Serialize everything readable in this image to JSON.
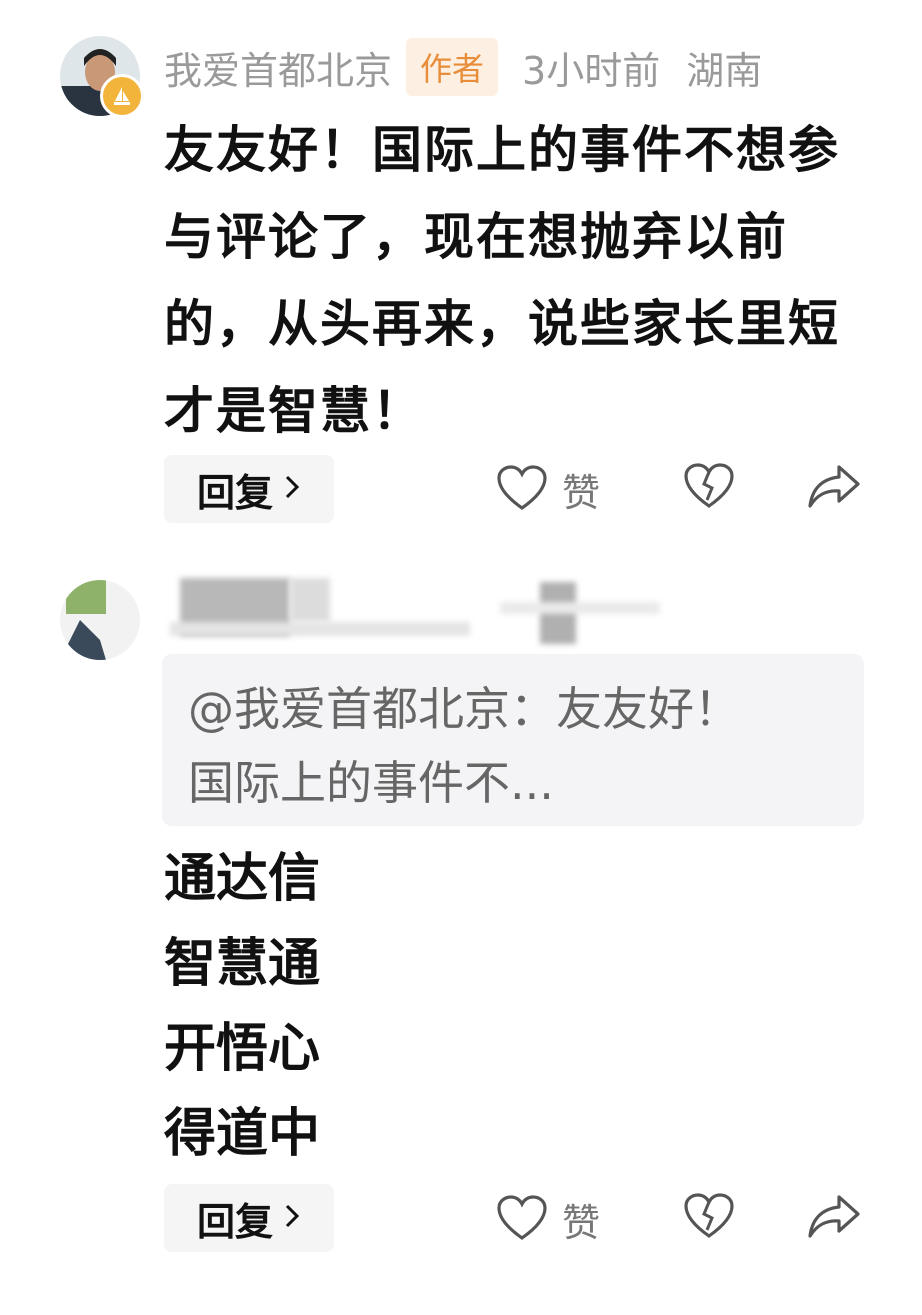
{
  "comments": [
    {
      "username": "我爱首都北京",
      "author_tag": "作者",
      "time": "3小时前",
      "region": "湖南",
      "text": "友友好！国际上的事件不想参与评论了，现在想抛弃以前的，从头再来，说些家长里短才是智慧！",
      "reply_label": "回复",
      "like_label": "赞"
    },
    {
      "quote": "@我爱首都北京：友友好！国际上的事件不...",
      "lines": [
        "通达信",
        "智慧通",
        "开悟心",
        "得道中"
      ],
      "reply_label": "回复",
      "like_label": "赞"
    }
  ],
  "icons": {
    "reply_chevron": "chevron-right-icon",
    "like": "heart-icon",
    "dislike": "broken-heart-icon",
    "share": "share-arrow-icon"
  },
  "colors": {
    "author_tag_bg": "#fdf0e2",
    "author_tag_text": "#e88d3a",
    "badge": "#f3b43b",
    "muted_text": "#9a9a9a"
  }
}
